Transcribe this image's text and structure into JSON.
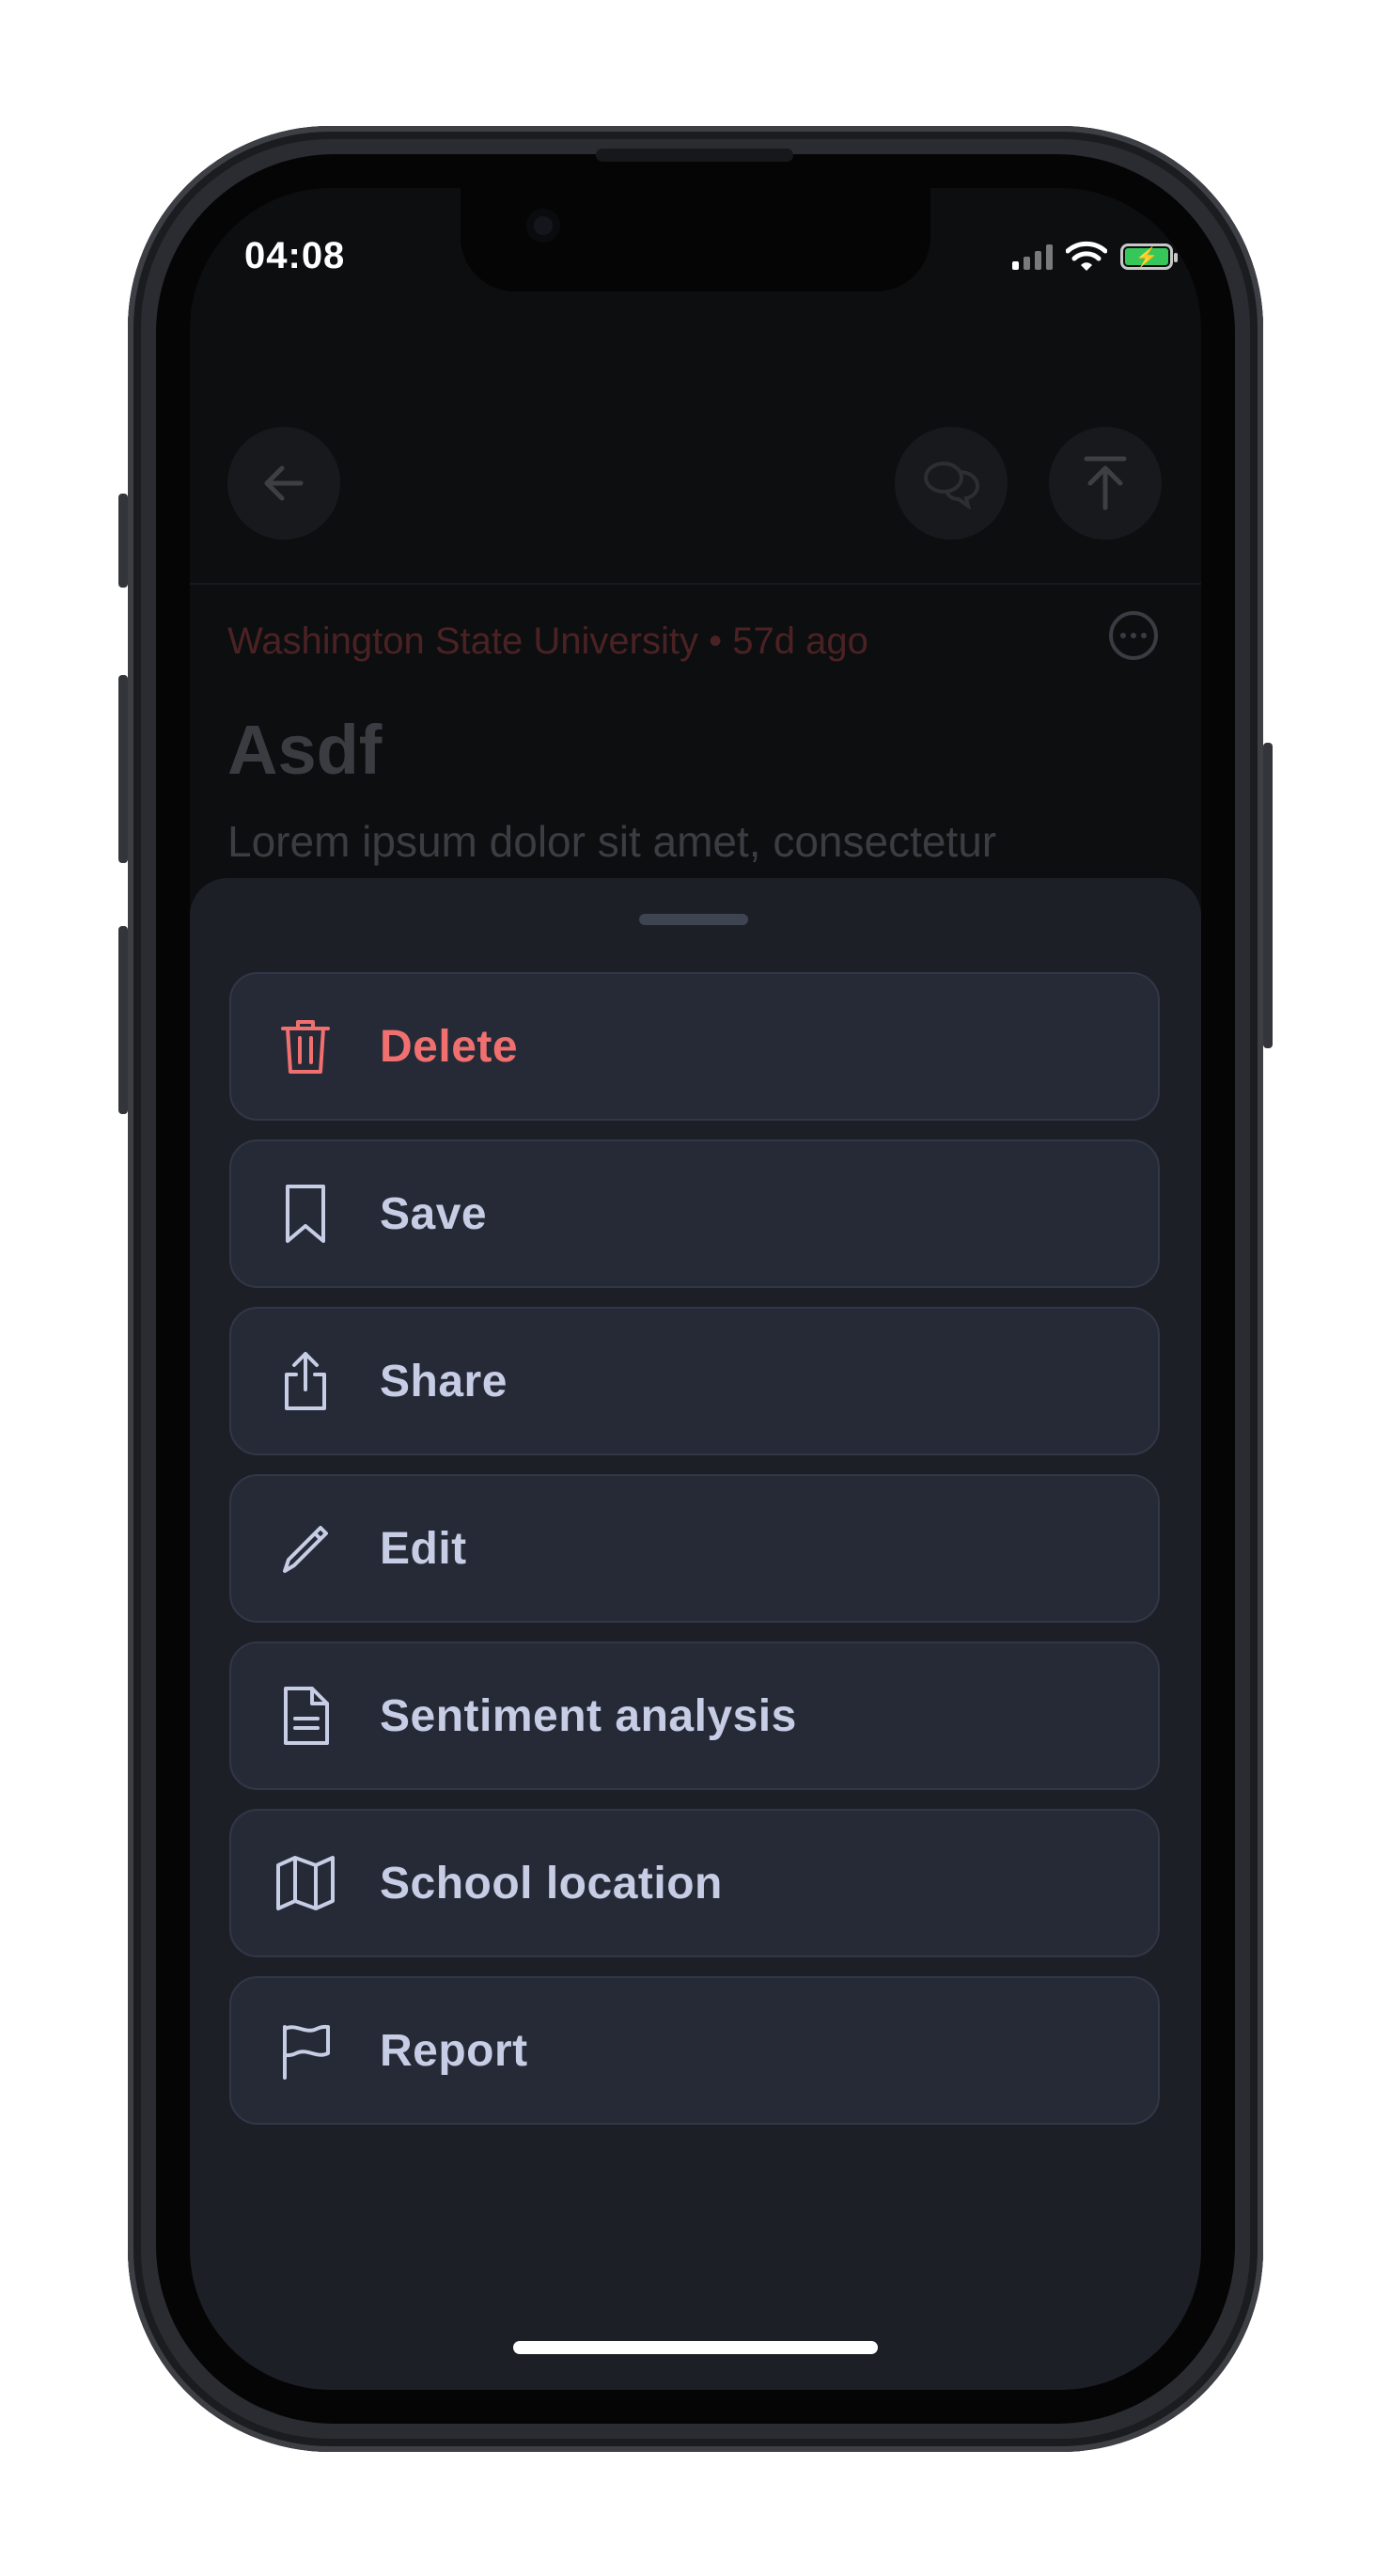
{
  "status_bar": {
    "time": "04:08"
  },
  "post": {
    "school": "Washington State University",
    "separator": "•",
    "age": "57d ago",
    "title": "Asdf",
    "body": "Lorem ipsum dolor sit amet, consectetur"
  },
  "action_sheet": {
    "options": [
      {
        "label": "Delete",
        "icon": "trash-icon",
        "color": "#f07070"
      },
      {
        "label": "Save",
        "icon": "bookmark-icon"
      },
      {
        "label": "Share",
        "icon": "share-icon"
      },
      {
        "label": "Edit",
        "icon": "pencil-icon"
      },
      {
        "label": "Sentiment analysis",
        "icon": "document-icon"
      },
      {
        "label": "School location",
        "icon": "map-icon"
      },
      {
        "label": "Report",
        "icon": "flag-icon"
      }
    ]
  },
  "colors": {
    "accent_danger": "#f07070",
    "sheet_bg": "#1d1f26",
    "option_bg": "#262a37",
    "option_text": "#c6cde4"
  }
}
